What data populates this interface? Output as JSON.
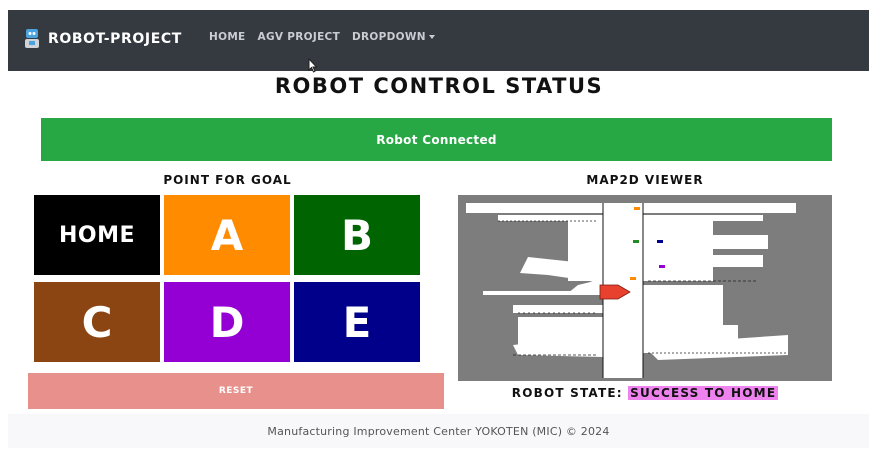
{
  "navbar": {
    "brand": "ROBOT-PROJECT",
    "brand_icon": "robot-icon",
    "links": [
      "HOME",
      "AGV PROJECT",
      "DROPDOWN"
    ]
  },
  "page": {
    "title": "ROBOT CONTROL STATUS",
    "connection_status": "Robot Connected"
  },
  "goal_panel": {
    "heading": "POINT FOR GOAL",
    "tiles": [
      {
        "label": "HOME",
        "color": "#000000"
      },
      {
        "label": "A",
        "color": "#ff8c00"
      },
      {
        "label": "B",
        "color": "#006400"
      },
      {
        "label": "C",
        "color": "#8b4513"
      },
      {
        "label": "D",
        "color": "#9400d3"
      },
      {
        "label": "E",
        "color": "#00008b"
      }
    ],
    "reset_label": "RESET"
  },
  "map_panel": {
    "heading": "MAP2D VIEWER"
  },
  "robot_state": {
    "label": "ROBOT STATE:",
    "value": "SUCCESS TO HOME"
  },
  "footer": {
    "text": "Manufacturing Improvement Center YOKOTEN (MIC) © 2024"
  },
  "colors": {
    "navbar": "#343a40",
    "connected": "#28a745",
    "reset": "#e8908c",
    "state_highlight": "#ee82ee"
  }
}
